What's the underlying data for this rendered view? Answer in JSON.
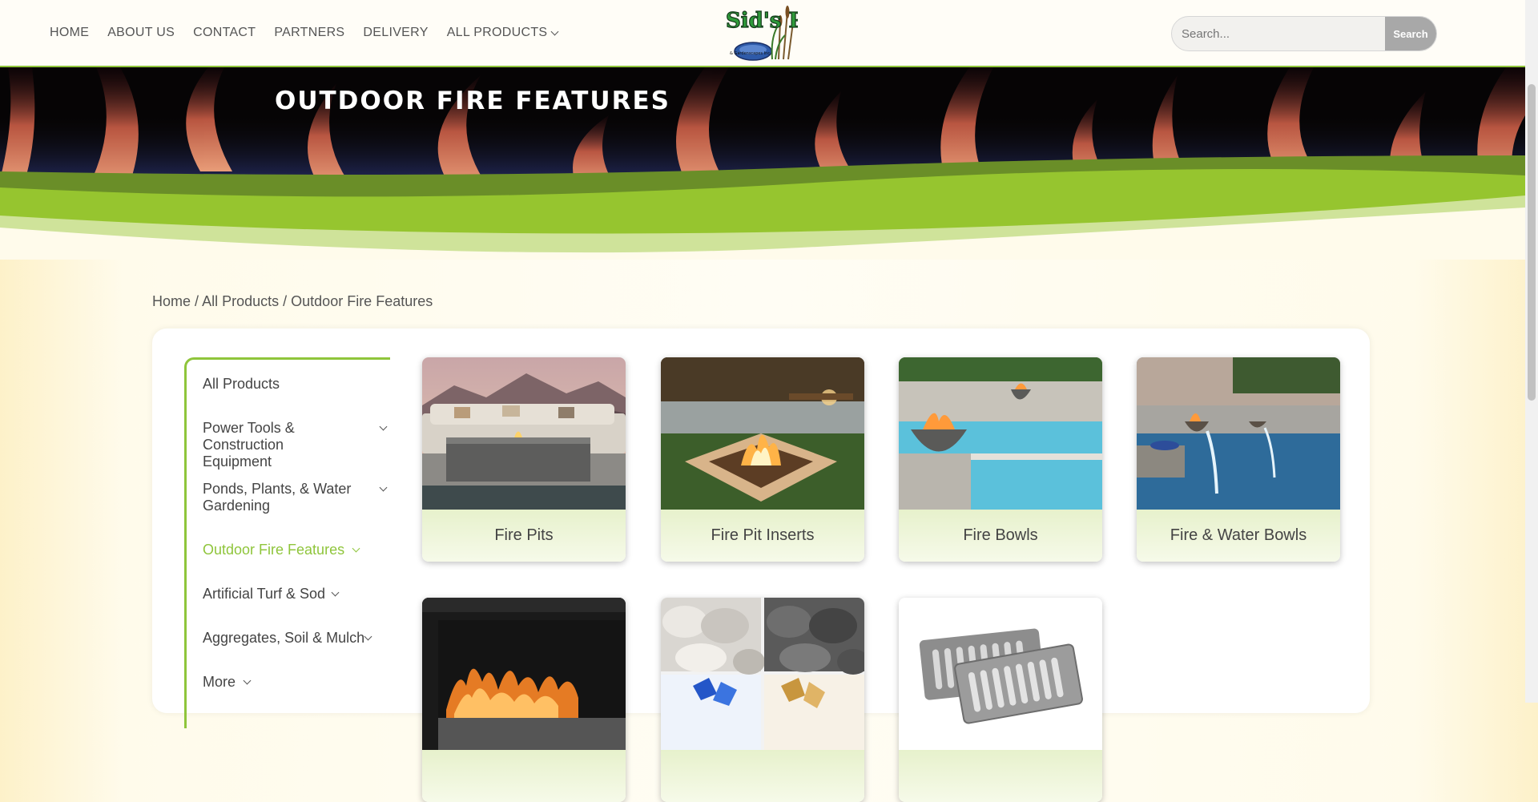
{
  "header": {
    "nav": [
      {
        "label": "HOME"
      },
      {
        "label": "ABOUT US"
      },
      {
        "label": "CONTACT"
      },
      {
        "label": "PARTNERS"
      },
      {
        "label": "DELIVERY"
      },
      {
        "label": "ALL PRODUCTS",
        "has_dropdown": true
      }
    ],
    "logo_text": "Sid's Ponds",
    "logo_subtext": "& Gardenscapes Inc.",
    "search": {
      "placeholder": "Search...",
      "button_label": "Search"
    }
  },
  "hero": {
    "title": "OUTDOOR FIRE FEATURES"
  },
  "breadcrumb": [
    {
      "label": "Home"
    },
    {
      "label": "All Products"
    },
    {
      "label": "Outdoor Fire Features"
    }
  ],
  "breadcrumb_separator": "/",
  "sidebar": {
    "items": [
      {
        "label": "All Products",
        "has_dropdown": false,
        "active": false
      },
      {
        "label": "Power Tools & Construction Equipment",
        "has_dropdown": true,
        "active": false
      },
      {
        "label": "Ponds, Plants, & Water Gardening",
        "has_dropdown": true,
        "active": false
      },
      {
        "label": "Outdoor Fire Features",
        "has_dropdown": true,
        "active": true
      },
      {
        "label": "Artificial Turf & Sod",
        "has_dropdown": true,
        "active": false
      },
      {
        "label": "Aggregates, Soil & Mulch",
        "has_dropdown": true,
        "active": false
      },
      {
        "label": "More",
        "has_dropdown": true,
        "active": false
      }
    ]
  },
  "products": [
    {
      "label": "Fire Pits"
    },
    {
      "label": "Fire Pit Inserts"
    },
    {
      "label": "Fire Bowls"
    },
    {
      "label": "Fire & Water Bowls"
    },
    {
      "label": ""
    },
    {
      "label": ""
    },
    {
      "label": ""
    }
  ],
  "colors": {
    "accent_green": "#8fc53b",
    "header_bg": "#fffdf7",
    "search_button": "#a8a8a8"
  }
}
